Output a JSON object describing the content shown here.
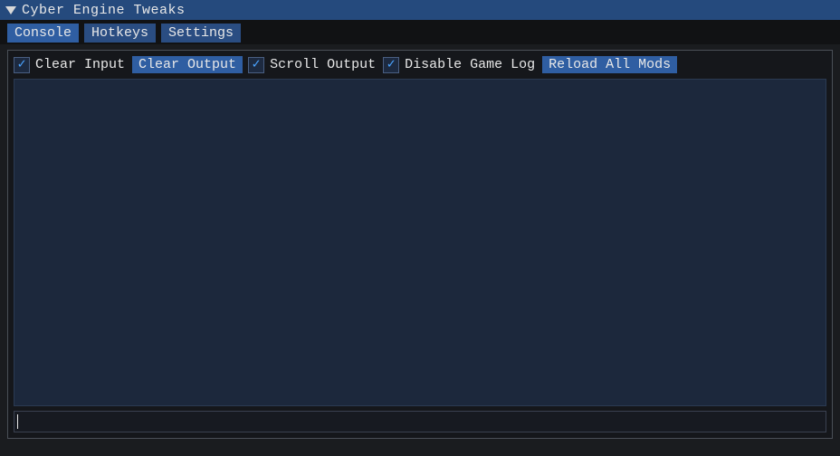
{
  "window": {
    "title": "Cyber Engine Tweaks"
  },
  "tabs": {
    "console": "Console",
    "hotkeys": "Hotkeys",
    "settings": "Settings"
  },
  "toolbar": {
    "clear_input_label": "Clear Input",
    "clear_output_label": "Clear Output",
    "scroll_output_label": "Scroll Output",
    "disable_game_log_label": "Disable Game Log",
    "reload_mods_label": "Reload All Mods"
  },
  "options": {
    "clear_input_checked": true,
    "scroll_output_checked": true,
    "disable_game_log_checked": true
  },
  "console": {
    "input_value": "",
    "output_text": ""
  }
}
